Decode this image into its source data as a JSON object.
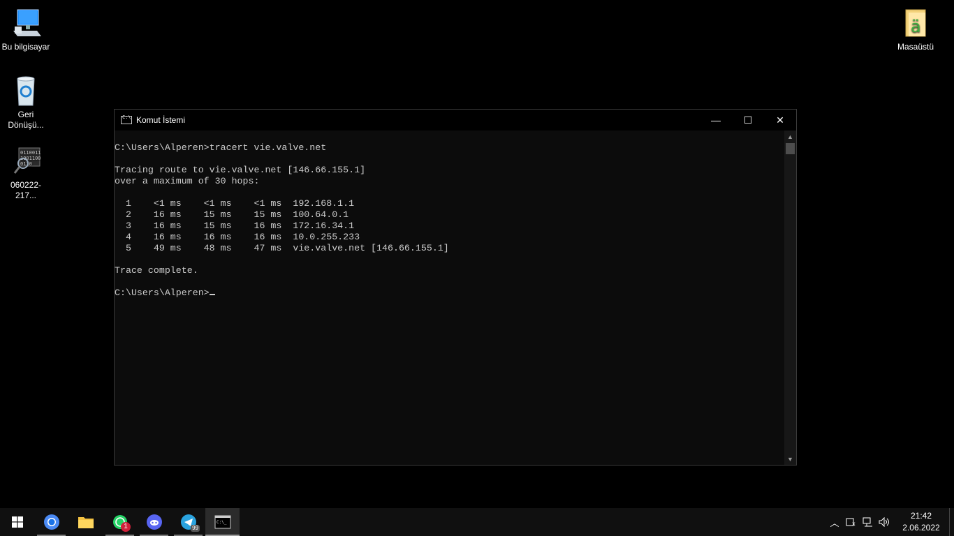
{
  "desktop": {
    "icons": [
      {
        "label": "Bu bilgisayar",
        "icon": "computer-icon"
      },
      {
        "label": "Geri\nDönüşü...",
        "icon": "recycle-bin-icon"
      },
      {
        "label": "060222-217...",
        "icon": "dump-file-icon"
      },
      {
        "label": "Masaüstü",
        "icon": "folder-icon"
      }
    ]
  },
  "window": {
    "title": "Komut İstemi",
    "controls": {
      "minimize": "—",
      "maximize": "☐",
      "close": "✕"
    },
    "console_text": "C:\\Users\\Alperen>tracert vie.valve.net\n\nTracing route to vie.valve.net [146.66.155.1]\nover a maximum of 30 hops:\n\n  1    <1 ms    <1 ms    <1 ms  192.168.1.1\n  2    16 ms    15 ms    15 ms  100.64.0.1\n  3    16 ms    15 ms    16 ms  172.16.34.1\n  4    16 ms    16 ms    16 ms  10.0.255.233\n  5    49 ms    48 ms    47 ms  vie.valve.net [146.66.155.1]\n\nTrace complete.\n\nC:\\Users\\Alperen>"
  },
  "taskbar": {
    "apps": [
      {
        "name": "start-button",
        "icon": "windows-logo-icon"
      },
      {
        "name": "chrome",
        "icon": "chrome-icon"
      },
      {
        "name": "file-explorer",
        "icon": "folder-icon"
      },
      {
        "name": "whatsapp",
        "icon": "whatsapp-icon",
        "badge": "1"
      },
      {
        "name": "discord",
        "icon": "discord-icon"
      },
      {
        "name": "telegram",
        "icon": "telegram-icon",
        "badge": "99"
      },
      {
        "name": "command-prompt",
        "icon": "cmd-icon"
      }
    ],
    "tray_icons": [
      "chevron-up-icon",
      "ime-icon",
      "network-icon",
      "volume-icon"
    ],
    "time": "21:42",
    "date": "2.06.2022"
  }
}
